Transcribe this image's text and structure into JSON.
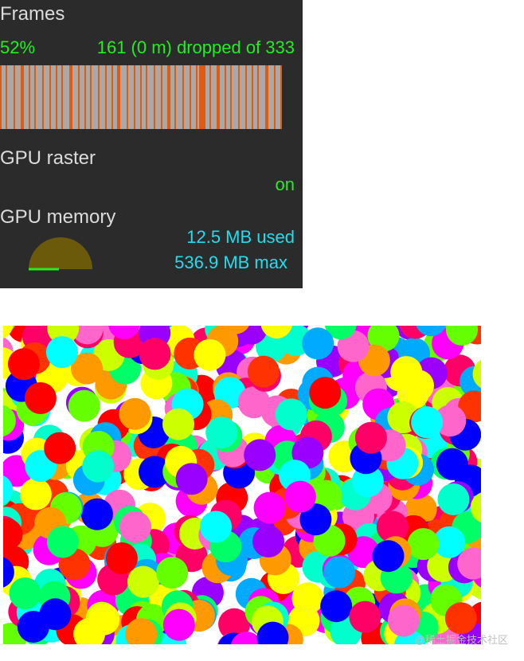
{
  "hud": {
    "frames_title": "Frames",
    "frames_percent": "52%",
    "frames_summary": "161 (0 m) dropped of 333",
    "gpu_raster_title": "GPU raster",
    "gpu_raster_status": "on",
    "gpu_memory_title": "GPU memory",
    "gpu_memory_used": "12.5 MB used",
    "gpu_memory_max": "536.9 MB max",
    "colors": {
      "background": "#2b2b2b",
      "label": "#dcdcdc",
      "good": "#22ee22",
      "info": "#22ddee",
      "dropped": "#e05a10",
      "gauge": "#6b5a0a"
    }
  },
  "canvas": {
    "palette": [
      "#ff0066",
      "#00ff66",
      "#ffff00",
      "#00ffff",
      "#ff00ff",
      "#0000ff",
      "#ff3300",
      "#66ff00",
      "#9900ff",
      "#00aaff",
      "#ff9900",
      "#ccff00",
      "#ff0000",
      "#00ffcc",
      "#ff66cc"
    ]
  },
  "watermark": "@稀土掘金技术社区"
}
